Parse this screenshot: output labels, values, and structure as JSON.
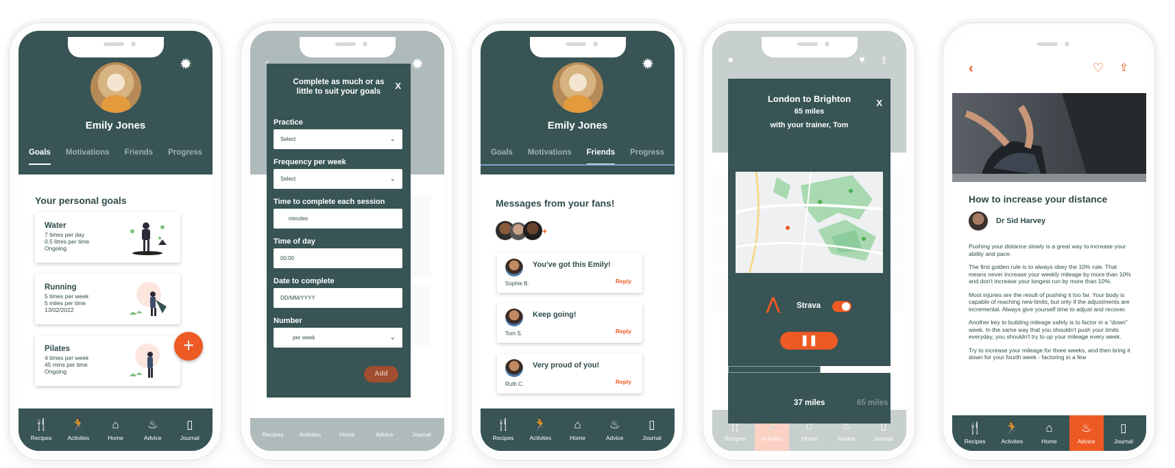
{
  "colors": {
    "teal": "#385454",
    "orange": "#ee5a24",
    "text": "#2f4a4a"
  },
  "nav": [
    "Recipes",
    "Activites",
    "Home",
    "Advice",
    "Journal"
  ],
  "nav_icons": [
    "cutlery-icon",
    "activity-icon",
    "home-icon",
    "advice-icon",
    "journal-icon"
  ],
  "profile": {
    "name": "Emily Jones",
    "tabs": [
      "Goals",
      "Motivations",
      "Friends",
      "Progress"
    ]
  },
  "goals": {
    "heading": "Your personal goals",
    "items": [
      {
        "title": "Water",
        "lines": [
          "7 times per day",
          "0.5 litres per time",
          "Ongoing"
        ]
      },
      {
        "title": "Running",
        "lines": [
          "5 times per week",
          "5 miles per time",
          "13/02/2022"
        ]
      },
      {
        "title": "Pilates",
        "lines": [
          "4 times per week",
          "45 mins per time",
          "Ongoing"
        ]
      }
    ]
  },
  "add_goal": {
    "title": "Complete as much or as little to suit your goals",
    "close": "X",
    "fields": [
      {
        "label": "Practice",
        "value": "Select"
      },
      {
        "label": "Frequency per week",
        "value": "Select"
      },
      {
        "label": "Time to complete each session",
        "value": "minutes"
      },
      {
        "label": "Time of day",
        "value": "00:00"
      },
      {
        "label": "Date to complete",
        "value": "DD/MM/YYYY"
      },
      {
        "label": "Number",
        "value": "per week"
      }
    ],
    "add": "Add"
  },
  "friends": {
    "heading": "Messages from your fans!",
    "messages": [
      {
        "text": "You've got this Emily!",
        "name": "Sophie B.",
        "reply": "Reply"
      },
      {
        "text": "Keep going!",
        "name": "Tom S.",
        "reply": "Reply"
      },
      {
        "text": "Very proud of you!",
        "name": "Ruth C.",
        "reply": "Reply"
      }
    ]
  },
  "activity": {
    "route": "London to Brighton",
    "distance": "65 miles",
    "trainer": "with your trainer, Tom",
    "close": "X",
    "strava": "Strava",
    "progress_current": "37 miles",
    "progress_total": "65 miles",
    "progress_fraction": 0.57
  },
  "article": {
    "title": "How to increase your distance",
    "author": "Dr Sid Harvey",
    "paragraphs": [
      "Pushing your distance slowly is a great way to increase your ability and pace.",
      "The first golden rule is to always obey the 10% rule. That means never increase your weekly mileage by more than 10% and don't increase your longest run by more than 10%.",
      "Most injuries are the result of pushing it too far. Your body is capable of reaching new limits, but only if the adjustments are incremental. Always give yourself time to adjust and recover.",
      "Another key to building mileage safely is to factor in a “down” week. In the same way that you shouldn't push your limits everyday, you shouldn't try to up your mileage every week.",
      "Try to increase your mileage for three weeks, and then bring it down for your fourth week - factoring in a few"
    ]
  }
}
